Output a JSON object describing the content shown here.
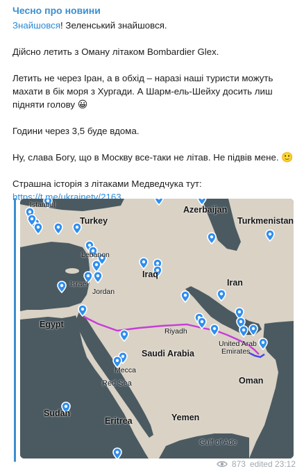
{
  "channel": {
    "name": "Чесно про новини"
  },
  "message": {
    "hashtag": "Знайшовся",
    "line1_rest": "! Зеленський знайшовся.",
    "p2": "Дійсно летить з Оману літаком Bombardier Glex.",
    "p3": "Летить не через Іран, а в обхід – наразі наші туристи можуть махати в бік моря з Хургади. А Шарм-ель-Шейху досить лиш підняти голову",
    "p3_emoji": "😀",
    "p4": "Години через 3,5 буде вдома.",
    "p5": "Ну, слава Богу, що в Москву все-таки не літав. Не підвів мене.",
    "p5_emoji": "🙂",
    "p6": "Страшна історія з літаками Медведчука тут:",
    "link": "https://t.me/ukrainetv/2163"
  },
  "map": {
    "labels": {
      "istanbul": "Istanbul",
      "azerbaijan": "Azerbaijan",
      "turkey": "Turkey",
      "turkmenistan": "Turkmenistan",
      "lebanon": "Lebanon",
      "iraq": "Iraq",
      "israel": "Israel",
      "jordan": "Jordan",
      "iran": "Iran",
      "egypt": "Egypt",
      "riyadh": "Riyadh",
      "united_arab_emirates_1": "United Arab",
      "united_arab_emirates_2": "Emirates",
      "saudi_arabia": "Saudi Arabia",
      "mecca": "Mecca",
      "red_sea": "Red Sea",
      "oman": "Oman",
      "sudan": "Sudan",
      "yemen": "Yemen",
      "eritrea": "Eritrea",
      "gulf_of_aden": "Gulf of Ade"
    },
    "colors": {
      "land": "#d9d2c5",
      "water": "#4b5a61",
      "marker": "#2f8ef0",
      "route_main": "#c83cd8",
      "route_end": "#3b45e8"
    }
  },
  "footer": {
    "views": "873",
    "edited": "edited 23:12"
  }
}
